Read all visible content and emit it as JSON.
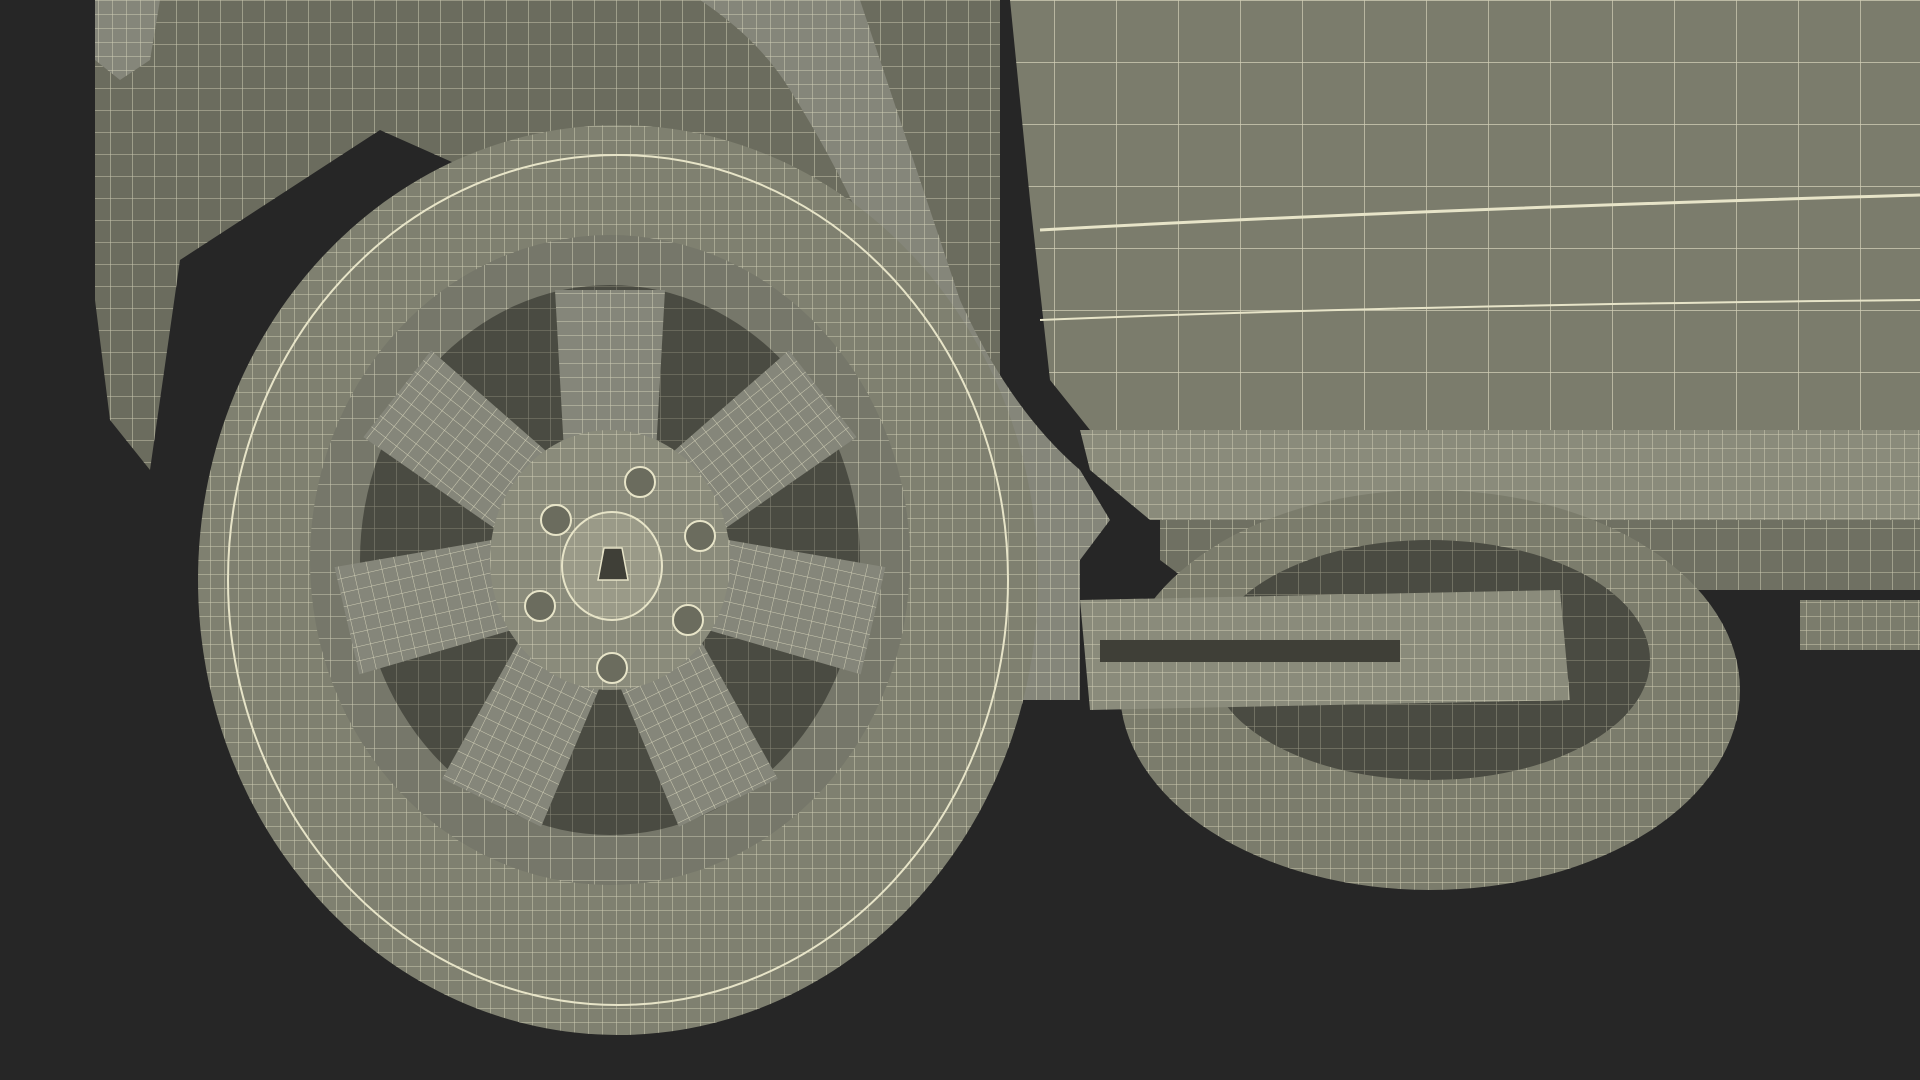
{
  "scene": {
    "subject": "vehicle",
    "render_style": "wireframe",
    "wheel_spokes": 7,
    "lug_nuts": 6,
    "colors": {
      "background": "#262626",
      "surface": "#7b7c6c",
      "surface_light": "#8a8b7b",
      "surface_dark": "#5f6055",
      "wire": "#e7e4c8",
      "shadow": "#3f3f37"
    }
  }
}
